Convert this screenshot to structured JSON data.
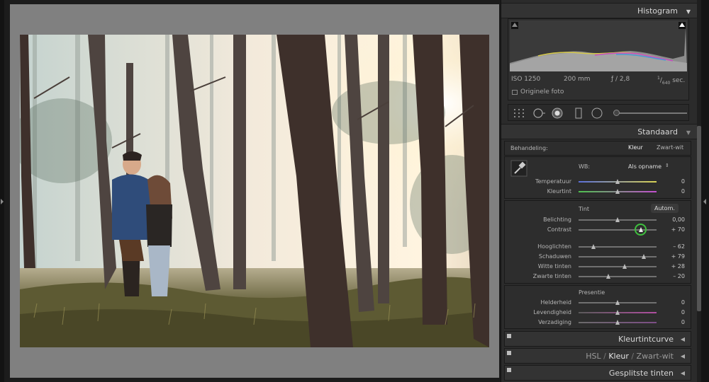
{
  "histogram": {
    "title": "Histogram",
    "iso": "ISO 1250",
    "focal": "200 mm",
    "aperture": "ƒ / 2,8",
    "shutter_num": "1",
    "shutter_den": "640",
    "shutter_unit": " sec.",
    "original_photo": "Originele foto"
  },
  "basic": {
    "title": "Standaard",
    "treatment_label": "Behandeling:",
    "treatment_color": "Kleur",
    "treatment_bw": "Zwart-wit",
    "wb_label": "WB:",
    "wb_value": "Als opname",
    "temperature": {
      "label": "Temperatuur",
      "value": "0"
    },
    "tint_slider": {
      "label": "Kleurtint",
      "value": "0"
    },
    "tone_label": "Tint",
    "auto_label": "Autom.",
    "exposure": {
      "label": "Belichting",
      "value": "0,00"
    },
    "contrast": {
      "label": "Contrast",
      "value": "+ 70"
    },
    "highlights": {
      "label": "Hooglichten",
      "value": "– 62"
    },
    "shadows": {
      "label": "Schaduwen",
      "value": "+ 79"
    },
    "whites": {
      "label": "Witte tinten",
      "value": "+ 28"
    },
    "blacks": {
      "label": "Zwarte tinten",
      "value": "– 20"
    },
    "presence_label": "Presentie",
    "clarity": {
      "label": "Helderheid",
      "value": "0"
    },
    "vibrance": {
      "label": "Levendigheid",
      "value": "0"
    },
    "saturation": {
      "label": "Verzadiging",
      "value": "0"
    }
  },
  "panels": {
    "tone_curve": "Kleurtintcurve",
    "hsl": "HSL",
    "hsl_sep": " / ",
    "hsl_color": "Kleur",
    "hsl_bw": "Zwart-wit",
    "split_toning": "Gesplitste tinten"
  },
  "colors": {
    "accent_green": "#3fbf3f",
    "panel_bg": "#2b2b2b",
    "canvas_gray": "#808080"
  }
}
